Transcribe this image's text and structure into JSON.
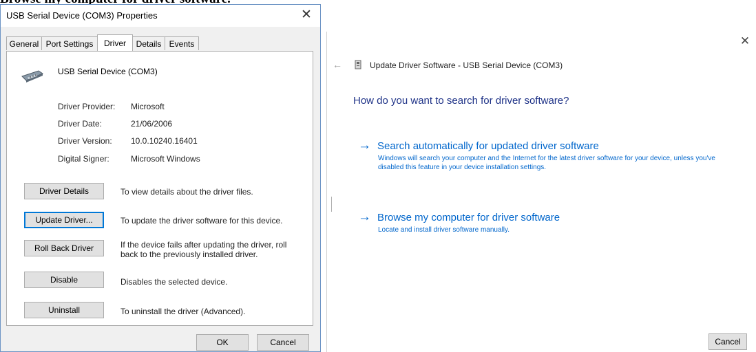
{
  "cut_heading": "Browse my computer for driver software.",
  "properties": {
    "title": "USB Serial Device (COM3) Properties",
    "close_glyph": "✕",
    "tabs": [
      "General",
      "Port Settings",
      "Driver",
      "Details",
      "Events"
    ],
    "active_tab": "Driver",
    "device_name": "USB Serial Device (COM3)",
    "device_icon": "serial-port-icon",
    "info": [
      {
        "label": "Driver Provider:",
        "value": "Microsoft"
      },
      {
        "label": "Driver Date:",
        "value": "21/06/2006"
      },
      {
        "label": "Driver Version:",
        "value": "10.0.10240.16401"
      },
      {
        "label": "Digital Signer:",
        "value": "Microsoft Windows"
      }
    ],
    "actions": [
      {
        "label": "Driver Details",
        "description": "To view details about the driver files."
      },
      {
        "label": "Update Driver...",
        "description": "To update the driver software for this device."
      },
      {
        "label": "Roll Back Driver",
        "description": "If the device fails after updating the driver, roll back to the previously installed driver."
      },
      {
        "label": "Disable",
        "description": "Disables the selected device."
      },
      {
        "label": "Uninstall",
        "description": "To uninstall the driver (Advanced)."
      }
    ],
    "ok_label": "OK",
    "cancel_label": "Cancel"
  },
  "wizard": {
    "close_glyph": "✕",
    "back_glyph": "←",
    "title": "Update Driver Software - USB Serial Device (COM3)",
    "heading": "How do you want to search for driver software?",
    "options": [
      {
        "arrow": "→",
        "title": "Search automatically for updated driver software",
        "description": "Windows will search your computer and the Internet for the latest driver software for your device, unless you've disabled this feature in your device installation settings."
      },
      {
        "arrow": "→",
        "title": "Browse my computer for driver software",
        "description": "Locate and install driver software manually."
      }
    ],
    "cancel_label": "Cancel"
  },
  "colors": {
    "link_blue": "#0066cc",
    "heading_navy": "#1e3287",
    "focus_blue": "#0078d7",
    "window_border": "#6b93c4"
  }
}
